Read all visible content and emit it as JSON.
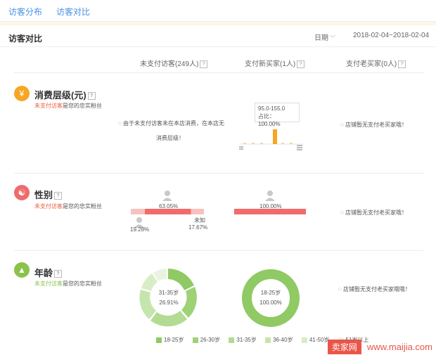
{
  "tabs": [
    {
      "label": "访客分布"
    },
    {
      "label": "访客对比"
    }
  ],
  "header": {
    "title": "访客对比",
    "date_label": "日期",
    "date_range": "2018-02-04~2018-02-04"
  },
  "columns": [
    {
      "label": "未支付访客(249人)"
    },
    {
      "label": "支付新买家(1人)"
    },
    {
      "label": "支付老买家(0人)"
    }
  ],
  "subtitle_highlight": "未支付访客",
  "subtitle_rest": "是您的忠实粉丝",
  "sections": {
    "consume": {
      "title": "消费层级(元)",
      "unpaid_note_line1": "由于未支付访客未在本店消费，在本店无",
      "unpaid_note_line2": "消费层级！",
      "tooltip_range": "95.0-155.0",
      "tooltip_ratio": "占比：100.00%",
      "old_note": "店铺暂无支付老买家哦！"
    },
    "gender": {
      "title": "性别",
      "unpaid_female_pct": "63.05%",
      "unpaid_male_pct": "19.28%",
      "unpaid_unknown_label": "未知",
      "unpaid_unknown_pct": "17.67%",
      "unpaid_shares": {
        "male": 19.28,
        "female": 63.05,
        "unknown": 17.67
      },
      "new_pct": "100.00%",
      "new_share": 100,
      "old_note": "店铺暂无支付老买家哦！"
    },
    "age": {
      "title": "年龄",
      "unpaid_center_label": "31-35岁",
      "unpaid_center_pct": "26.91%",
      "new_center_label": "18-25岁",
      "new_center_pct": "100.00%",
      "old_note": "店铺暂无支付老买家哦哦！"
    }
  },
  "age_legend": [
    {
      "label": "18-25岁",
      "color": "#8fca64"
    },
    {
      "label": "26-30岁",
      "color": "#9fd277"
    },
    {
      "label": "31-35岁",
      "color": "#b3dc92"
    },
    {
      "label": "36-40岁",
      "color": "#c6e5ad"
    },
    {
      "label": "41-50岁",
      "color": "#d8edc7"
    },
    {
      "label": "51岁以上",
      "color": "#e8f4df"
    }
  ],
  "chart_data": [
    {
      "type": "bar",
      "title": "",
      "categories": [
        "95.0-155.0"
      ],
      "values": [
        100
      ],
      "ylabel": "占比"
    },
    {
      "type": "pie",
      "title": "",
      "categories": [
        "31-35岁"
      ],
      "values": [
        26.91
      ]
    },
    {
      "type": "pie",
      "title": "",
      "categories": [
        "18-25岁"
      ],
      "values": [
        100
      ]
    }
  ],
  "colors": {
    "accent": "#4a90e2",
    "consume_icon": "#f5a623",
    "gender_icon": "#f06b6b",
    "age_icon": "#8bc34a",
    "bar": "#f5a623",
    "gender_bar": "#f06b6b",
    "gender_bar_light": "#f9c0c0"
  },
  "watermark": {
    "brand": "卖家网",
    "url": "www.maijia.com"
  }
}
